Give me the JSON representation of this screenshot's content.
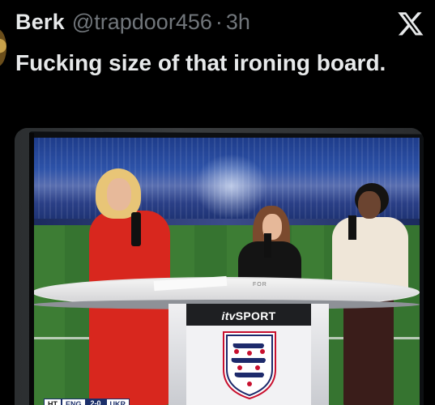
{
  "tweet": {
    "author_name": "Berk",
    "handle": "@trapdoor456",
    "separator": "·",
    "time": "3h",
    "text": "Fucking size of that ironing board."
  },
  "icons": {
    "brand": "x-logo-icon",
    "avatar": "avatar"
  },
  "image": {
    "desk_logo_prefix": "itv",
    "desk_logo_suffix": "SPORT",
    "desk_small_text": "FOR",
    "scorebug": {
      "period": "HT",
      "home": "ENG",
      "score": "2-0",
      "away": "UKR"
    }
  },
  "colors": {
    "background": "#000000",
    "text_primary": "#e7e9ea",
    "text_secondary": "#71767b",
    "presenter_suit": "#d8271e"
  }
}
